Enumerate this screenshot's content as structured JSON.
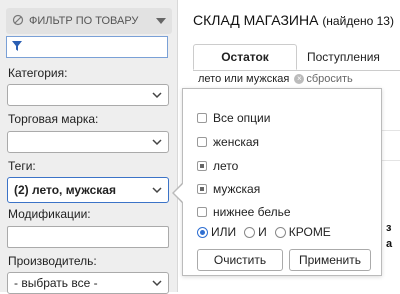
{
  "sidebar": {
    "header_title": "ФИЛЬТР ПО ТОВАРУ",
    "category_label": "Категория:",
    "category_value": "",
    "brand_label": "Торговая марка:",
    "brand_value": "",
    "tags_label": "Теги:",
    "tags_value": "(2) лето, мужская",
    "modifications_label": "Модификации:",
    "modifications_value": "",
    "manufacturer_label": "Производитель:",
    "manufacturer_value": "- выбрать все -"
  },
  "main": {
    "title": "СКЛАД МАГАЗИНА",
    "found": "(найдено 13)",
    "tabs": [
      {
        "label": "Остаток",
        "active": true
      },
      {
        "label": "Поступления",
        "active": false
      }
    ],
    "active_filter": "лето или мужская",
    "reset_label": "сбросить",
    "peek_rows": [
      "з",
      "а"
    ]
  },
  "popup": {
    "options": [
      {
        "label": "Все опции",
        "checked": false
      },
      {
        "label": "женская",
        "checked": false
      },
      {
        "label": "лето",
        "checked": true
      },
      {
        "label": "мужская",
        "checked": true
      },
      {
        "label": "нижнее белье",
        "checked": false
      }
    ],
    "modes": [
      {
        "label": "ИЛИ",
        "selected": true
      },
      {
        "label": "И",
        "selected": false
      },
      {
        "label": "КРОМЕ",
        "selected": false
      }
    ],
    "clear_label": "Очистить",
    "apply_label": "Применить"
  },
  "colors": {
    "accent": "#3b73c7",
    "sidebar_bg": "#eeeeee"
  }
}
